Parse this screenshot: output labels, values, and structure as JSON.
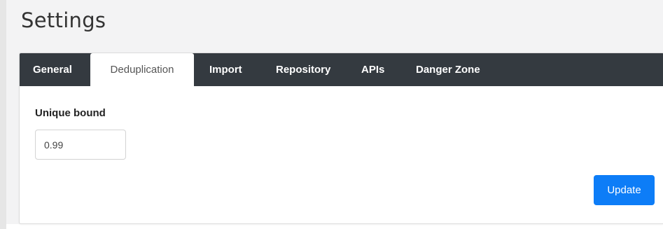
{
  "page": {
    "title": "Settings"
  },
  "tabs": [
    {
      "label": "General",
      "active": false
    },
    {
      "label": "Deduplication",
      "active": true
    },
    {
      "label": "Import",
      "active": false
    },
    {
      "label": "Repository",
      "active": false
    },
    {
      "label": "APIs",
      "active": false
    },
    {
      "label": "Danger Zone",
      "active": false
    }
  ],
  "form": {
    "unique_bound_label": "Unique bound",
    "unique_bound_value": "0.99",
    "update_label": "Update"
  },
  "colors": {
    "tabbar_background": "#343a40",
    "primary_button": "#0d7df7",
    "page_background": "#f3f3f4"
  }
}
